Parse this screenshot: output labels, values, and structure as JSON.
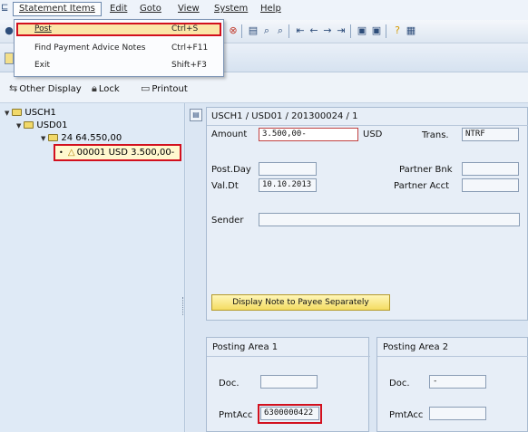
{
  "menubar": {
    "items": [
      "Statement Items",
      "Edit",
      "Goto",
      "View",
      "System",
      "Help"
    ]
  },
  "dropdown": {
    "items": [
      {
        "label": "Post",
        "shortcut": "Ctrl+S"
      },
      {
        "label": "Find Payment Advice Notes",
        "shortcut": "Ctrl+F11"
      },
      {
        "label": "Exit",
        "shortcut": "Shift+F3"
      }
    ]
  },
  "app_toolbar": {
    "other_display": "Other Display",
    "lock": "Lock",
    "printout": "Printout"
  },
  "tree": {
    "root": "USCH1",
    "child": "USD01",
    "group": "24  64.550,00",
    "item": "00001  USD 3.500,00-"
  },
  "detail": {
    "header": "USCH1 / USD01 / 201300024 / 1",
    "amount_label": "Amount",
    "amount_value": "3.500,00-",
    "currency": "USD",
    "trans_label": "Trans.",
    "trans_value": "NTRF",
    "post_day_label": "Post.Day",
    "post_day_value": "",
    "val_dt_label": "Val.Dt",
    "val_dt_value": "10.10.2013",
    "partner_bank_label": "Partner Bnk",
    "partner_acct_label": "Partner Acct",
    "sender_label": "Sender",
    "note_button": "Display Note to Payee Separately"
  },
  "posting_area_1": {
    "title": "Posting Area 1",
    "doc_label": "Doc.",
    "doc_value": "",
    "pmtacc_label": "PmtAcc",
    "pmtacc_value": "6300000422"
  },
  "posting_area_2": {
    "title": "Posting Area 2",
    "doc_label": "Doc.",
    "doc_value": "-",
    "pmtacc_label": "PmtAcc",
    "pmtacc_value": ""
  },
  "colors": {
    "highlight": "#d2101e",
    "menu_selected": "#fbe6a8"
  }
}
